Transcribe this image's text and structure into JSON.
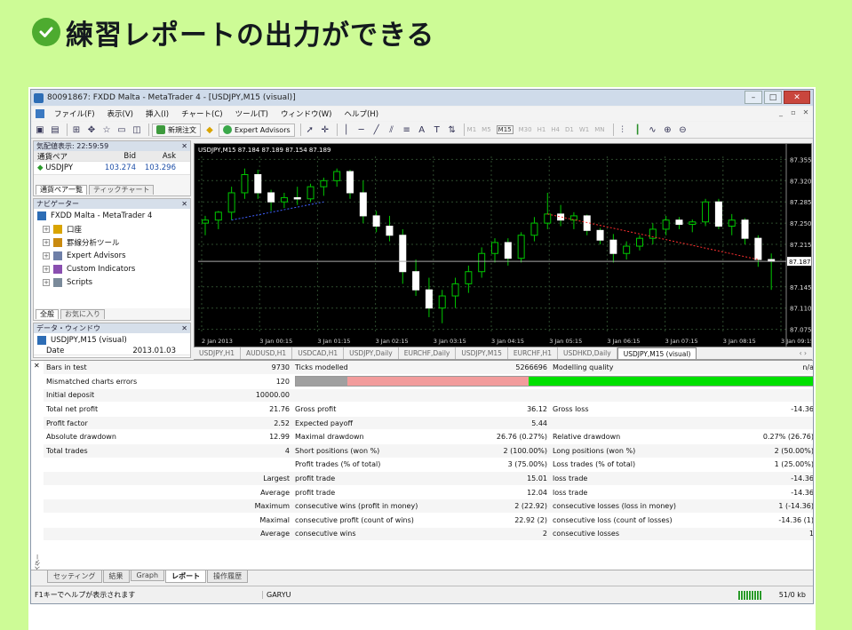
{
  "page": {
    "heading": "練習レポートの出力ができる",
    "accent": "#4dab2f",
    "background": "#cdfb96"
  },
  "app": {
    "title": "80091867: FXDD Malta - MetaTrader 4 - [USDJPY,M15 (visual)]",
    "window_buttons": [
      "–",
      "□",
      "✕"
    ],
    "menu": [
      "ファイル(F)",
      "表示(V)",
      "挿入(I)",
      "チャート(C)",
      "ツール(T)",
      "ウィンドウ(W)",
      "ヘルプ(H)"
    ],
    "toolbar": {
      "new_order": "新規注文",
      "expert_advisors": "Expert Advisors",
      "timeframes": [
        "M1",
        "M5",
        "M15",
        "M30",
        "H1",
        "H4",
        "D1",
        "W1",
        "MN"
      ],
      "active_timeframe": "M15"
    }
  },
  "market_watch": {
    "title": "気配値表示: 22:59:59",
    "headers": [
      "通貨ペア",
      "Bid",
      "Ask"
    ],
    "rows": [
      {
        "symbol": "USDJPY",
        "bid": "103.274",
        "ask": "103.296"
      }
    ],
    "tabs": [
      "通貨ペア一覧",
      "ティックチャート"
    ]
  },
  "navigator": {
    "title": "ナビゲーター",
    "root": "FXDD Malta - MetaTrader 4",
    "items": [
      "口座",
      "罫線分析ツール",
      "Expert Advisors",
      "Custom Indicators",
      "Scripts"
    ],
    "tabs": [
      "全般",
      "お気に入り"
    ]
  },
  "data_window": {
    "title": "データ・ウィンドウ",
    "symbol": "USDJPY,M15 (visual)",
    "row_label": "Date",
    "row_value": "2013.01.03"
  },
  "chart": {
    "header": "USDJPY,M15  87.184 87.189 87.154 87.189",
    "price_labels": [
      "87.355",
      "87.320",
      "87.285",
      "87.250",
      "87.215",
      "87.187",
      "87.145",
      "87.110",
      "87.075"
    ],
    "current_price": "87.187",
    "time_labels": [
      "2 Jan 2013",
      "3 Jan 00:15",
      "3 Jan 01:15",
      "3 Jan 02:15",
      "3 Jan 03:15",
      "3 Jan 04:15",
      "3 Jan 05:15",
      "3 Jan 06:15",
      "3 Jan 07:15",
      "3 Jan 08:15",
      "3 Jan 09:15"
    ],
    "bull_color": "#00c800",
    "bear_color": "#ffffff",
    "candles": [
      {
        "o": 87.25,
        "h": 87.262,
        "l": 87.23,
        "c": 87.255
      },
      {
        "o": 87.255,
        "h": 87.27,
        "l": 87.24,
        "c": 87.268
      },
      {
        "o": 87.268,
        "h": 87.31,
        "l": 87.255,
        "c": 87.3
      },
      {
        "o": 87.3,
        "h": 87.34,
        "l": 87.29,
        "c": 87.33
      },
      {
        "o": 87.33,
        "h": 87.338,
        "l": 87.29,
        "c": 87.3
      },
      {
        "o": 87.3,
        "h": 87.305,
        "l": 87.27,
        "c": 87.285
      },
      {
        "o": 87.285,
        "h": 87.3,
        "l": 87.275,
        "c": 87.292
      },
      {
        "o": 87.292,
        "h": 87.31,
        "l": 87.28,
        "c": 87.29
      },
      {
        "o": 87.29,
        "h": 87.315,
        "l": 87.285,
        "c": 87.31
      },
      {
        "o": 87.31,
        "h": 87.325,
        "l": 87.295,
        "c": 87.32
      },
      {
        "o": 87.32,
        "h": 87.34,
        "l": 87.31,
        "c": 87.335
      },
      {
        "o": 87.335,
        "h": 87.338,
        "l": 87.29,
        "c": 87.3
      },
      {
        "o": 87.3,
        "h": 87.32,
        "l": 87.25,
        "c": 87.262
      },
      {
        "o": 87.262,
        "h": 87.27,
        "l": 87.235,
        "c": 87.245
      },
      {
        "o": 87.245,
        "h": 87.262,
        "l": 87.22,
        "c": 87.23
      },
      {
        "o": 87.23,
        "h": 87.24,
        "l": 87.15,
        "c": 87.17
      },
      {
        "o": 87.17,
        "h": 87.19,
        "l": 87.13,
        "c": 87.14
      },
      {
        "o": 87.14,
        "h": 87.16,
        "l": 87.095,
        "c": 87.11
      },
      {
        "o": 87.11,
        "h": 87.14,
        "l": 87.085,
        "c": 87.13
      },
      {
        "o": 87.13,
        "h": 87.16,
        "l": 87.11,
        "c": 87.15
      },
      {
        "o": 87.15,
        "h": 87.18,
        "l": 87.135,
        "c": 87.17
      },
      {
        "o": 87.17,
        "h": 87.21,
        "l": 87.16,
        "c": 87.2
      },
      {
        "o": 87.2,
        "h": 87.225,
        "l": 87.185,
        "c": 87.218
      },
      {
        "o": 87.218,
        "h": 87.225,
        "l": 87.18,
        "c": 87.192
      },
      {
        "o": 87.192,
        "h": 87.235,
        "l": 87.185,
        "c": 87.23
      },
      {
        "o": 87.23,
        "h": 87.26,
        "l": 87.22,
        "c": 87.25
      },
      {
        "o": 87.25,
        "h": 87.3,
        "l": 87.24,
        "c": 87.265
      },
      {
        "o": 87.265,
        "h": 87.28,
        "l": 87.245,
        "c": 87.255
      },
      {
        "o": 87.255,
        "h": 87.268,
        "l": 87.24,
        "c": 87.262
      },
      {
        "o": 87.262,
        "h": 87.264,
        "l": 87.23,
        "c": 87.238
      },
      {
        "o": 87.238,
        "h": 87.242,
        "l": 87.215,
        "c": 87.222
      },
      {
        "o": 87.222,
        "h": 87.232,
        "l": 87.185,
        "c": 87.2
      },
      {
        "o": 87.2,
        "h": 87.22,
        "l": 87.19,
        "c": 87.212
      },
      {
        "o": 87.212,
        "h": 87.23,
        "l": 87.205,
        "c": 87.225
      },
      {
        "o": 87.225,
        "h": 87.25,
        "l": 87.215,
        "c": 87.24
      },
      {
        "o": 87.24,
        "h": 87.262,
        "l": 87.23,
        "c": 87.255
      },
      {
        "o": 87.255,
        "h": 87.26,
        "l": 87.24,
        "c": 87.248
      },
      {
        "o": 87.248,
        "h": 87.256,
        "l": 87.235,
        "c": 87.252
      },
      {
        "o": 87.252,
        "h": 87.29,
        "l": 87.245,
        "c": 87.285
      },
      {
        "o": 87.285,
        "h": 87.29,
        "l": 87.24,
        "c": 87.245
      },
      {
        "o": 87.245,
        "h": 87.265,
        "l": 87.23,
        "c": 87.255
      },
      {
        "o": 87.255,
        "h": 87.258,
        "l": 87.215,
        "c": 87.225
      },
      {
        "o": 87.225,
        "h": 87.23,
        "l": 87.178,
        "c": 87.19
      },
      {
        "o": 87.19,
        "h": 87.2,
        "l": 87.14,
        "c": 87.187
      }
    ]
  },
  "chart_tabs": [
    "USDJPY,H1",
    "AUDUSD,H1",
    "USDCAD,H1",
    "USDJPY,Daily",
    "EURCHF,Daily",
    "USDJPY,M15",
    "EURCHF,H1",
    "USDHKD,Daily",
    "USDJPY,M15 (visual)"
  ],
  "report": {
    "rows": [
      [
        "Bars in test",
        "9730",
        "Ticks modelled",
        "5266696",
        "Modelling quality",
        "n/a"
      ],
      [
        "Mismatched charts errors",
        "120",
        "",
        "",
        "",
        ""
      ],
      [
        "Initial deposit",
        "10000.00",
        "",
        "",
        "",
        ""
      ],
      [
        "Total net profit",
        "21.76",
        "Gross profit",
        "36.12",
        "Gross loss",
        "-14.36"
      ],
      [
        "Profit factor",
        "2.52",
        "Expected payoff",
        "5.44",
        "",
        ""
      ],
      [
        "Absolute drawdown",
        "12.99",
        "Maximal drawdown",
        "26.76 (0.27%)",
        "Relative drawdown",
        "0.27% (26.76)"
      ],
      [
        "Total trades",
        "4",
        "Short positions (won %)",
        "2 (100.00%)",
        "Long positions (won %)",
        "2 (50.00%)"
      ],
      [
        "",
        "",
        "Profit trades (% of total)",
        "3 (75.00%)",
        "Loss trades (% of total)",
        "1 (25.00%)"
      ],
      [
        "",
        "Largest",
        "profit trade",
        "15.01",
        "loss trade",
        "-14.36"
      ],
      [
        "",
        "Average",
        "profit trade",
        "12.04",
        "loss trade",
        "-14.36"
      ],
      [
        "",
        "Maximum",
        "consecutive wins (profit in money)",
        "2 (22.92)",
        "consecutive losses (loss in money)",
        "1 (-14.36)"
      ],
      [
        "",
        "Maximal",
        "consecutive profit (count of wins)",
        "22.92 (2)",
        "consecutive loss (count of losses)",
        "-14.36 (1)"
      ],
      [
        "",
        "Average",
        "consecutive wins",
        "2",
        "consecutive losses",
        "1"
      ]
    ],
    "quality_bar": [
      {
        "fraction": 0.1,
        "color": "#a0a0a0"
      },
      {
        "fraction": 0.35,
        "color": "#f29c9c"
      },
      {
        "fraction": 0.55,
        "color": "#00e000"
      }
    ]
  },
  "terminal_label": "テスター",
  "bottom_tabs": [
    "セッティング",
    "結果",
    "Graph",
    "レポート",
    "操作履歴"
  ],
  "active_bottom_tab": "レポート",
  "status": {
    "help": "F1キーでヘルプが表示されます",
    "profile": "GARYU",
    "traffic": "51/0 kb"
  }
}
